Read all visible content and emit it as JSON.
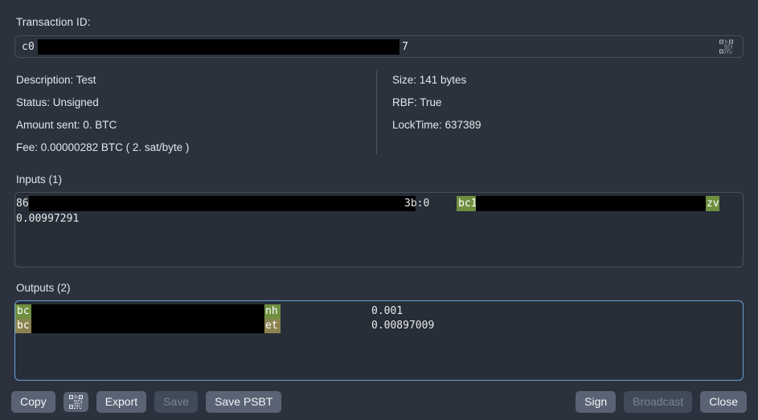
{
  "dialog": {
    "txid_label": "Transaction ID:",
    "txid_value_prefix": "c0",
    "txid_value_suffix": "7",
    "qr_inline_icon": "qr-code-icon"
  },
  "details": {
    "left": [
      "Description: Test",
      "Status: Unsigned",
      "Amount sent: 0. BTC",
      "Fee: 0.00000282 BTC  ( 2. sat/byte )"
    ],
    "right": [
      "Size: 141 bytes",
      "RBF: True",
      "LockTime: 637389"
    ]
  },
  "inputs": {
    "label": "Inputs (1)",
    "rows": [
      {
        "outpoint_prefix": "86",
        "outpoint_suffix": "3b:0",
        "address_prefix": "bc1",
        "address_suffix": "zv",
        "amount": "0.00997291"
      }
    ]
  },
  "outputs": {
    "label": "Outputs (2)",
    "rows": [
      {
        "address_prefix": "bc",
        "address_suffix": "nh",
        "amount": "0.001",
        "highlight": "green"
      },
      {
        "address_prefix": "bc",
        "address_suffix": "et",
        "amount": "0.00897009",
        "highlight": "olive"
      }
    ]
  },
  "footer": {
    "left_buttons": [
      {
        "label": "Copy",
        "name": "copy-button",
        "disabled": false
      },
      {
        "label": "",
        "name": "qr-button",
        "disabled": false,
        "icon": "qr-code-icon"
      },
      {
        "label": "Export",
        "name": "export-button",
        "disabled": false
      },
      {
        "label": "Save",
        "name": "save-button",
        "disabled": true
      },
      {
        "label": "Save PSBT",
        "name": "save-psbt-button",
        "disabled": false
      }
    ],
    "right_buttons": [
      {
        "label": "Sign",
        "name": "sign-button",
        "disabled": false
      },
      {
        "label": "Broadcast",
        "name": "broadcast-button",
        "disabled": true
      },
      {
        "label": "Close",
        "name": "close-button",
        "disabled": false
      }
    ]
  },
  "colors": {
    "background": "#2b323d",
    "field_background": "#272e38",
    "border": "#4a515d",
    "focus_border": "#6aa3d8",
    "highlight_green": "#6e8f40",
    "highlight_olive": "#8c8250",
    "button": "#5a6373",
    "button_disabled": "#414a58",
    "text": "#e8eaed"
  }
}
